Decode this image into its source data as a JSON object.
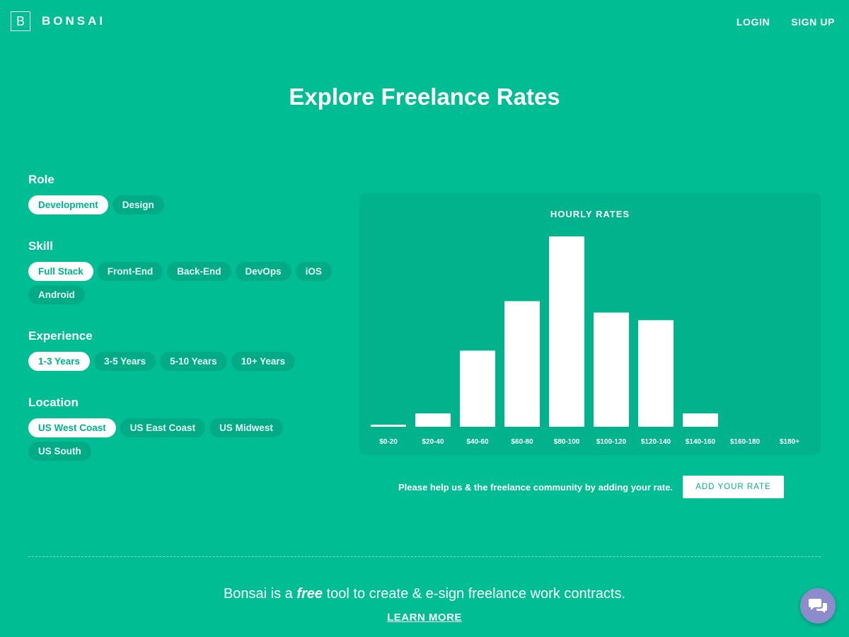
{
  "header": {
    "logo_letter": "B",
    "logo_text": "BONSAI",
    "nav": {
      "login": "LOGIN",
      "signup": "SIGN UP"
    }
  },
  "page_title": "Explore Freelance Rates",
  "filters": {
    "role": {
      "label": "Role",
      "options": [
        "Development",
        "Design"
      ],
      "selected": "Development"
    },
    "skill": {
      "label": "Skill",
      "options": [
        "Full Stack",
        "Front-End",
        "Back-End",
        "DevOps",
        "iOS",
        "Android"
      ],
      "selected": "Full Stack"
    },
    "experience": {
      "label": "Experience",
      "options": [
        "1-3 Years",
        "3-5 Years",
        "5-10 Years",
        "10+ Years"
      ],
      "selected": "1-3 Years"
    },
    "location": {
      "label": "Location",
      "options": [
        "US West Coast",
        "US East Coast",
        "US Midwest",
        "US South"
      ],
      "selected": "US West Coast"
    }
  },
  "chart_data": {
    "type": "bar",
    "title": "HOURLY RATES",
    "categories": [
      "$0-20",
      "$20-40",
      "$40-60",
      "$60-80",
      "$80-100",
      "$100-120",
      "$120-140",
      "$140-160",
      "$160-180",
      "$180+"
    ],
    "values": [
      1,
      7,
      40,
      66,
      100,
      60,
      56,
      7,
      0,
      0
    ],
    "xlabel": "",
    "ylabel": "",
    "ylim": [
      0,
      100
    ],
    "grid": false,
    "bar_color": "#ffffff"
  },
  "cta": {
    "text": "Please help us & the freelance community by adding your rate.",
    "button": "ADD YOUR RATE"
  },
  "footer": {
    "text_before": "Bonsai is a ",
    "text_em": "free",
    "text_after": " tool to create & e-sign freelance work contracts.",
    "learn_more": "LEARN MORE"
  },
  "chat": {
    "icon": "chat-icon"
  },
  "colors": {
    "background": "#00bd94",
    "card": "#00b38d",
    "pill": "#00ab86",
    "accent_text": "#00b28c",
    "chat": "#8e8bcc"
  }
}
